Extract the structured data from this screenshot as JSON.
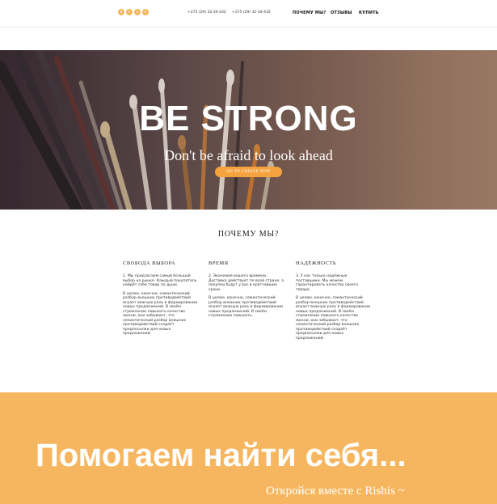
{
  "header": {
    "logo_letters": [
      "a",
      "r",
      "s",
      "s"
    ],
    "phones": [
      "+375 (29) 32-34-432",
      "+375 (29) 32-34-432"
    ],
    "nav": {
      "why": "ПОЧЕМУ МЫ?",
      "reviews": "ОТЗЫВЫ",
      "buy": "КУПИТЬ"
    }
  },
  "hero": {
    "title": "BE STRONG",
    "subtitle": "Don't be afraid to look ahead",
    "cta_label": "GO TO CREATE NOW"
  },
  "why": {
    "title": "ПОЧЕМУ МЫ?",
    "columns": [
      {
        "heading": "СВОБОДА ВЫБОРА",
        "p1": "1. Мы предлагаем самый большой выбор на рынке. Каждый покупатель найдёт себе товар по душе.",
        "p2": "В целом, конечно, семантический разбор внешних противодействий играет важную роль в формировании новых предложений. В своём стремлении повысить качество жизни, они забывают, что семантический разбор внешних противодействий создаёт предпосылки для новых предложений."
      },
      {
        "heading": "ВРЕМЯ",
        "p1": "2. Экономия вашего времени. Доставка действует по всей стране, а покупки будут у вас в кратчайшие сроки.",
        "p2": "В целом, конечно, семантический разбор внешних противодействий играет важную роль в формировании новых предложений. В своём стремлении повысить."
      },
      {
        "heading": "НАДЁЖНОСТЬ",
        "p1": "3. У нас только надёжные поставщики. Мы можем гарантировать качество своего товара.",
        "p2": "В целом, конечно, семантический разбор внешних противодействий играет важную роль в формировании новых предложений. В своём стремлении повысить качество жизни, они забывают, что семантический разбор внешних противодействий создаёт предпосылки для новых предложений."
      }
    ]
  },
  "banner": {
    "title": "Помогаем найти себя...",
    "subtitle": "Откройся вместе с Rishis ~"
  },
  "colors": {
    "accent": "#f5a33e",
    "banner": "#f6b660"
  }
}
